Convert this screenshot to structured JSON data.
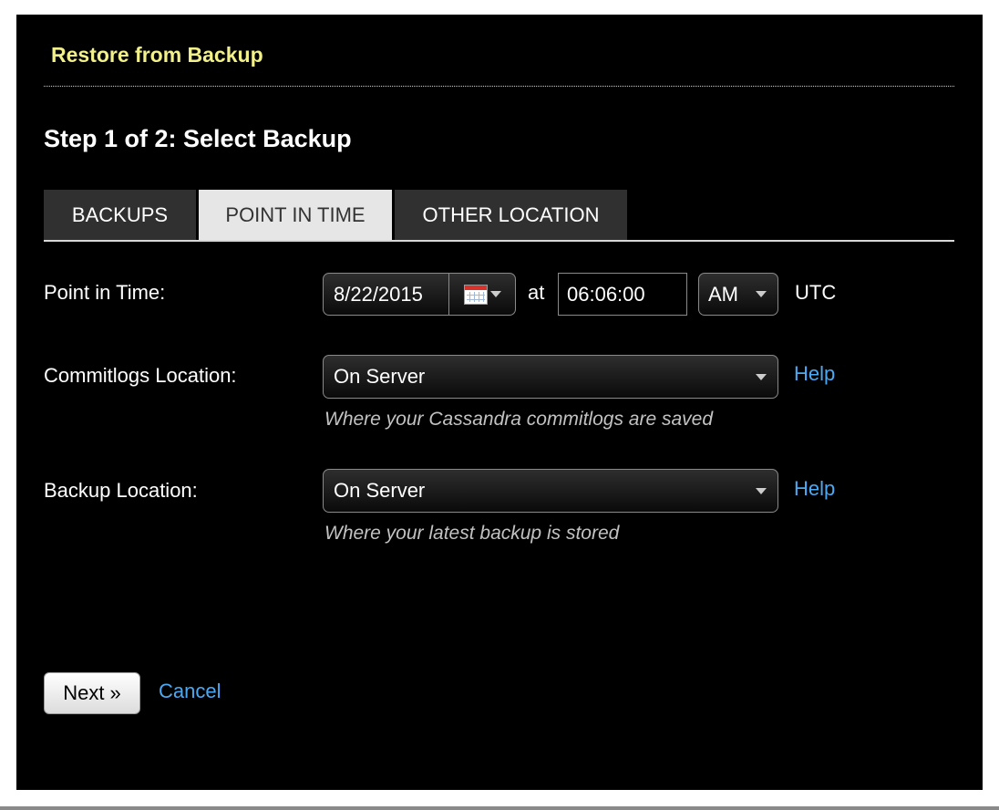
{
  "dialog": {
    "title": "Restore from Backup",
    "step_heading": "Step 1 of 2: Select Backup"
  },
  "tabs": [
    {
      "label": "BACKUPS",
      "active": false
    },
    {
      "label": "POINT IN TIME",
      "active": true
    },
    {
      "label": "OTHER LOCATION",
      "active": false
    }
  ],
  "point_in_time": {
    "label": "Point in Time:",
    "date": "8/22/2015",
    "at_label": "at",
    "time": "06:06:00",
    "ampm": "AM",
    "timezone": "UTC",
    "calendar_icon": "calendar-icon"
  },
  "commitlogs": {
    "label": "Commitlogs Location:",
    "value": "On Server",
    "help": "Help",
    "hint": "Where your Cassandra commitlogs are saved"
  },
  "backup_location": {
    "label": "Backup Location:",
    "value": "On Server",
    "help": "Help",
    "hint": "Where your latest backup is stored"
  },
  "actions": {
    "next": "Next »",
    "cancel": "Cancel"
  },
  "colors": {
    "background": "#000000",
    "title": "#f2f08a",
    "link": "#4aa9f2",
    "active_tab": "#e6e6e6",
    "inactive_tab": "#303030",
    "hint": "#c2c2c2"
  }
}
